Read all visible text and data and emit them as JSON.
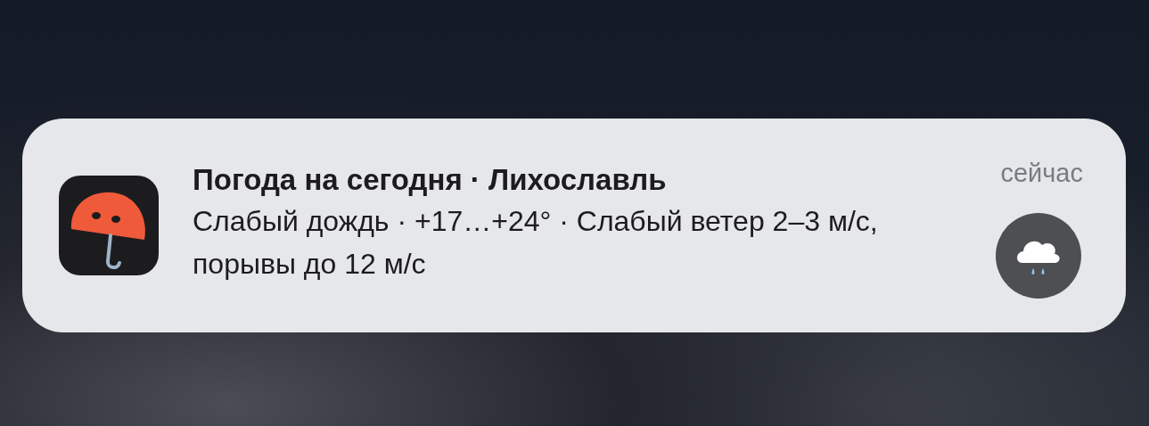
{
  "notification": {
    "title": "Погода на сегодня · Лихославль",
    "body": "Слабый дождь · +17…+24° · Слабый ветер 2–3 м/с, порывы до 12 м/с",
    "time": "сейчас"
  }
}
